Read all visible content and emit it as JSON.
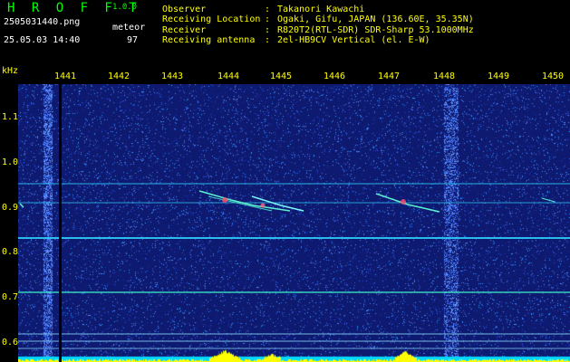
{
  "header": {
    "app_title": "H R O F F T",
    "app_version": "1.0.0",
    "file_name": "2505031440.png",
    "date_time": "25.05.03 14:40",
    "detection_label": "meteor",
    "detection_count": "97"
  },
  "info": [
    {
      "key": "Observer",
      "sep": ":",
      "value": "Takanori Kawachi"
    },
    {
      "key": "Receiving Location",
      "sep": ":",
      "value": "Ogaki, Gifu, JAPAN (136.60E, 35.35N)"
    },
    {
      "key": "Receiver",
      "sep": ":",
      "value": "R820T2(RTL-SDR) SDR-Sharp 53.1000MHz"
    },
    {
      "key": "Receiving antenna",
      "sep": ":",
      "value": "2el-HB9CV Vertical (el. E-W)"
    }
  ],
  "axes": {
    "freq_unit": "kHz",
    "freq_ticks": [
      "1.1",
      "1.0",
      "0.9",
      "0.8",
      "0.7",
      "0.6"
    ],
    "time_ticks": [
      "1441",
      "1442",
      "1443",
      "1444",
      "1445",
      "1446",
      "1447",
      "1448",
      "1449",
      "1450"
    ]
  },
  "colors": {
    "header_title": "#00ff00",
    "header_text": "#ffffff",
    "info_text": "#ffff00",
    "tick_text": "#ffff00",
    "background": "#000000",
    "spectrogram_base": "#0e1a70",
    "signal": "#00ffff",
    "bottom_level": "#ffff00"
  }
}
